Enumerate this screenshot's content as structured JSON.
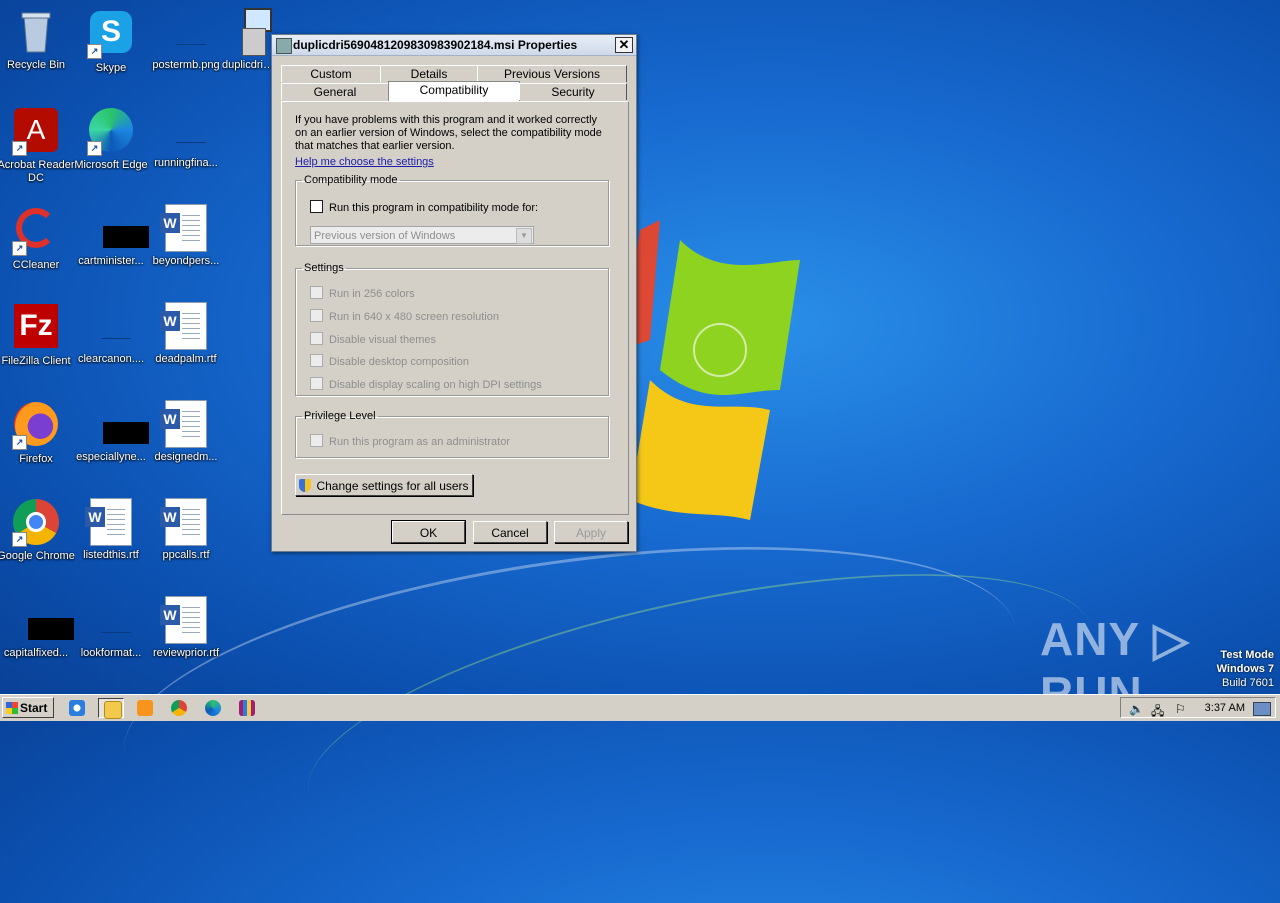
{
  "desktop": {
    "icons": [
      {
        "label": "Recycle Bin"
      },
      {
        "label": "Skype"
      },
      {
        "label": "postermb.png"
      },
      {
        "label": "duplicdri5..."
      },
      {
        "label": "Acrobat Reader DC"
      },
      {
        "label": "Microsoft Edge"
      },
      {
        "label": "runningfina..."
      },
      {
        "label": "CCleaner"
      },
      {
        "label": "cartminister..."
      },
      {
        "label": "beyondpers..."
      },
      {
        "label": "FileZilla Client"
      },
      {
        "label": "clearcanon...."
      },
      {
        "label": "deadpalm.rtf"
      },
      {
        "label": "Firefox"
      },
      {
        "label": "especiallyne..."
      },
      {
        "label": "designedm..."
      },
      {
        "label": "Google Chrome"
      },
      {
        "label": "listedthis.rtf"
      },
      {
        "label": "ppcalls.rtf"
      },
      {
        "label": "capitalfixed..."
      },
      {
        "label": "lookformat..."
      },
      {
        "label": "reviewprior.rtf"
      }
    ],
    "watermark": {
      "line1": "Test Mode",
      "line2": "Windows 7",
      "line3": "Build 7601"
    },
    "brand": "ANY ▷ RUN"
  },
  "dialog": {
    "title": "duplicdri56904812098309839021 84.msi Properties",
    "title_text": "duplicdri5690481209830983902184.msi Properties",
    "close": "✕",
    "tabs_back": [
      "Custom",
      "Details",
      "Previous Versions"
    ],
    "tabs_front": [
      "General",
      "Compatibility",
      "Security"
    ],
    "active_tab": "Compatibility",
    "intro": "If you have problems with this program and it worked correctly on an earlier version of Windows, select the compatibility mode that matches that earlier version.",
    "help_link": "Help me choose the settings",
    "compat_group": "Compatibility mode",
    "compat_check": "Run this program in compatibility mode for:",
    "compat_select": "Previous version of Windows",
    "settings_group": "Settings",
    "settings": [
      "Run in 256 colors",
      "Run in 640 x 480 screen resolution",
      "Disable visual themes",
      "Disable desktop composition",
      "Disable display scaling on high DPI settings"
    ],
    "privilege_group": "Privilege Level",
    "privilege_check": "Run this program as an administrator",
    "change_all": "Change settings for all users",
    "ok": "OK",
    "cancel": "Cancel",
    "apply": "Apply"
  },
  "taskbar": {
    "start": "Start",
    "clock": "3:37 AM"
  }
}
